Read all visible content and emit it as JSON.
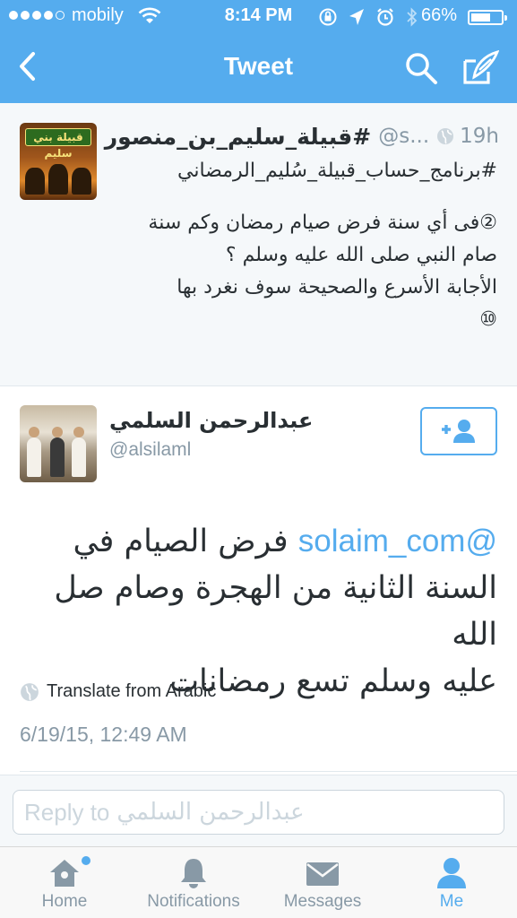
{
  "status_bar": {
    "carrier": "mobily",
    "time": "8:14 PM",
    "battery_percent": "66%",
    "battery_level": 0.66,
    "signal_bars": 4
  },
  "nav": {
    "title": "Tweet",
    "back_icon": "chevron-left-icon",
    "search_icon": "search-icon",
    "compose_icon": "compose-icon"
  },
  "original_tweet": {
    "display_name": "#قبيلة_سليم_بن_منصور",
    "handle": "@s...",
    "time": "19h",
    "hashtags": "#برنامج_حساب_قبيلة_سُليم_الرمضاني",
    "avatar_banner": "قبيلة بني سليم",
    "lines": [
      "②فى أي سنة فرض صيام رمضان وكم سنة",
      "صام النبي صلى الله عليه وسلم ؟",
      "الأجابة الأسرع والصحيحة سوف نغرد بها",
      "⑩"
    ]
  },
  "reply_tweet": {
    "display_name": "عبدالرحمن السلمي",
    "handle": "@alsilaml",
    "mention": "@solaim_com",
    "text_first": "فرض الصيام في",
    "text_rest": [
      "السنة الثانية من الهجرة وصام صل الله",
      "عليه وسلم تسع رمضانات"
    ],
    "translate_label": "Translate from Arabic",
    "timestamp": "6/19/15, 12:49 AM"
  },
  "reply_box": {
    "placeholder_prefix": "Reply to",
    "placeholder_name": "عبدالرحمن السلمي"
  },
  "tabs": [
    {
      "label": "Home",
      "icon": "home-icon",
      "active": false,
      "badge": true
    },
    {
      "label": "Notifications",
      "icon": "bell-icon",
      "active": false,
      "badge": false
    },
    {
      "label": "Messages",
      "icon": "envelope-icon",
      "active": false,
      "badge": false
    },
    {
      "label": "Me",
      "icon": "person-icon",
      "active": true,
      "badge": false
    }
  ],
  "colors": {
    "accent": "#55acee",
    "text": "#292f33",
    "muted": "#8899a6"
  }
}
